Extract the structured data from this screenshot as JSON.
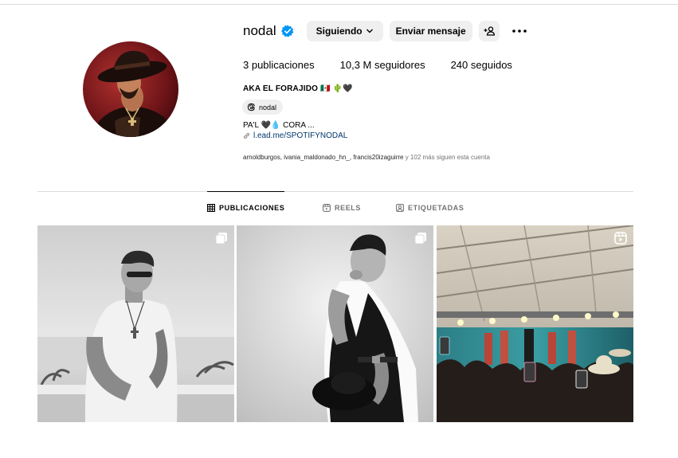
{
  "profile": {
    "username": "nodal",
    "follow_button": "Siguiendo",
    "message_button": "Enviar mensaje",
    "stats": {
      "posts": "3 publicaciones",
      "followers": "10,3 M seguidores",
      "following": "240 seguidos"
    },
    "full_name": "AKA EL FORAJIDO 🇲🇽 🌵🖤",
    "threads_label": "nodal",
    "bio": "PA'L 🖤💧 CORA ...",
    "link": "l.ead.me/SPOTIFYNODAL",
    "followed_by_names": "arnoldburgos, ivania_maldonado_hn_, francis20izaguirre",
    "followed_by_rest": " y 102 más siguen esta cuenta"
  },
  "tabs": [
    {
      "label": "PUBLICACIONES",
      "icon": "grid-icon",
      "active": true
    },
    {
      "label": "REELS",
      "icon": "reels-icon",
      "active": false
    },
    {
      "label": "ETIQUETADAS",
      "icon": "tagged-icon",
      "active": false
    }
  ],
  "posts": [
    {
      "type": "carousel",
      "badge": "carousel-icon",
      "style": "bw-beach-portrait"
    },
    {
      "type": "carousel",
      "badge": "carousel-icon",
      "style": "bw-studio-portrait"
    },
    {
      "type": "reel",
      "badge": "reel-icon",
      "style": "color-concert"
    }
  ],
  "colors": {
    "verified": "#0095f6",
    "button_bg": "#efefef",
    "link": "#00376b",
    "muted": "#737373",
    "divider": "#dbdbdb"
  }
}
